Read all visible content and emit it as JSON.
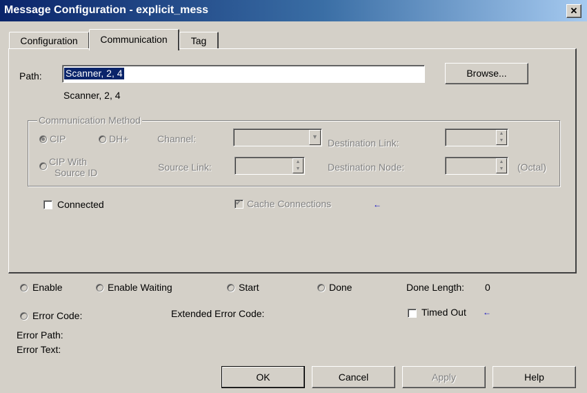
{
  "window": {
    "title": "Message Configuration - explicit_mess",
    "close_glyph": "✕"
  },
  "tabs": [
    {
      "label": "Configuration",
      "active": false
    },
    {
      "label": "Communication",
      "active": true
    },
    {
      "label": "Tag",
      "active": false
    }
  ],
  "communication": {
    "path_label": "Path:",
    "path_value": "Scanner, 2, 4",
    "path_resolved": "Scanner, 2, 4",
    "browse_label": "Browse...",
    "method_group_label": "Communication Method",
    "cip_label": "CIP",
    "dhplus_label": "DH+",
    "channel_label": "Channel:",
    "destination_link_label": "Destination Link:",
    "cip_with_source_label_line1": "CIP With",
    "cip_with_source_label_line2": "Source ID",
    "source_link_label": "Source Link:",
    "destination_node_label": "Destination Node:",
    "octal_label": "(Octal)",
    "connected_label": "Connected",
    "cache_connections_label": "Cache Connections"
  },
  "status": {
    "enable_label": "Enable",
    "enable_waiting_label": "Enable Waiting",
    "start_label": "Start",
    "done_label": "Done",
    "done_length_label": "Done Length:",
    "done_length_value": "0",
    "error_code_label": "Error Code:",
    "extended_error_code_label": "Extended Error Code:",
    "timed_out_label": "Timed Out",
    "error_path_label": "Error Path:",
    "error_text_label": "Error Text:"
  },
  "buttons": {
    "ok": "OK",
    "cancel": "Cancel",
    "apply": "Apply",
    "help": "Help"
  },
  "colors": {
    "titlebar": "#0a246a",
    "face": "#d4d0c8",
    "selection": "#0a246a",
    "accent_arrow": "#0000c0"
  }
}
